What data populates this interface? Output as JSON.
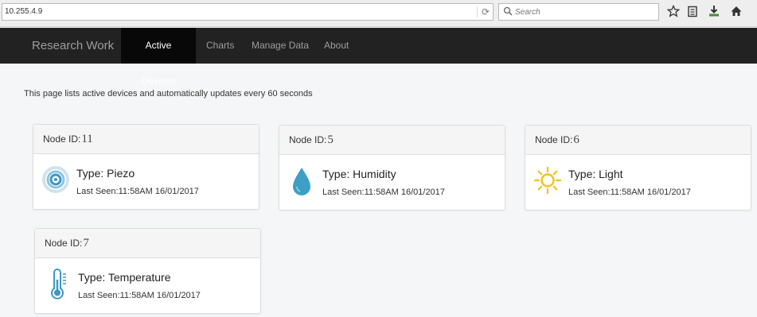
{
  "browser": {
    "url": "10.255.4.9",
    "search_placeholder": "Search"
  },
  "navbar": {
    "brand": "Research Work",
    "items": [
      {
        "label": "Active Devices",
        "active": true
      },
      {
        "label": "Charts",
        "active": false
      },
      {
        "label": "Manage Data",
        "active": false
      },
      {
        "label": "About",
        "active": false
      }
    ]
  },
  "page": {
    "intro": "This page lists active devices and automatically updates every 60 seconds",
    "node_id_label": "Node ID:",
    "type_prefix": "Type:",
    "last_seen_prefix": "Last Seen:"
  },
  "devices": [
    {
      "node_id": "11",
      "type": "Piezo",
      "last_seen": "11:58AM 16/01/2017",
      "icon": "piezo-icon",
      "color": "#3b98c4"
    },
    {
      "node_id": "5",
      "type": "Humidity",
      "last_seen": "11:58AM 16/01/2017",
      "icon": "water-drop-icon",
      "color": "#3d9fc5"
    },
    {
      "node_id": "6",
      "type": "Light",
      "last_seen": "11:58AM 16/01/2017",
      "icon": "sun-icon",
      "color": "#f2c219"
    },
    {
      "node_id": "7",
      "type": "Temperature",
      "last_seen": "11:58AM 16/01/2017",
      "icon": "thermometer-icon",
      "color": "#3b98c4"
    }
  ]
}
